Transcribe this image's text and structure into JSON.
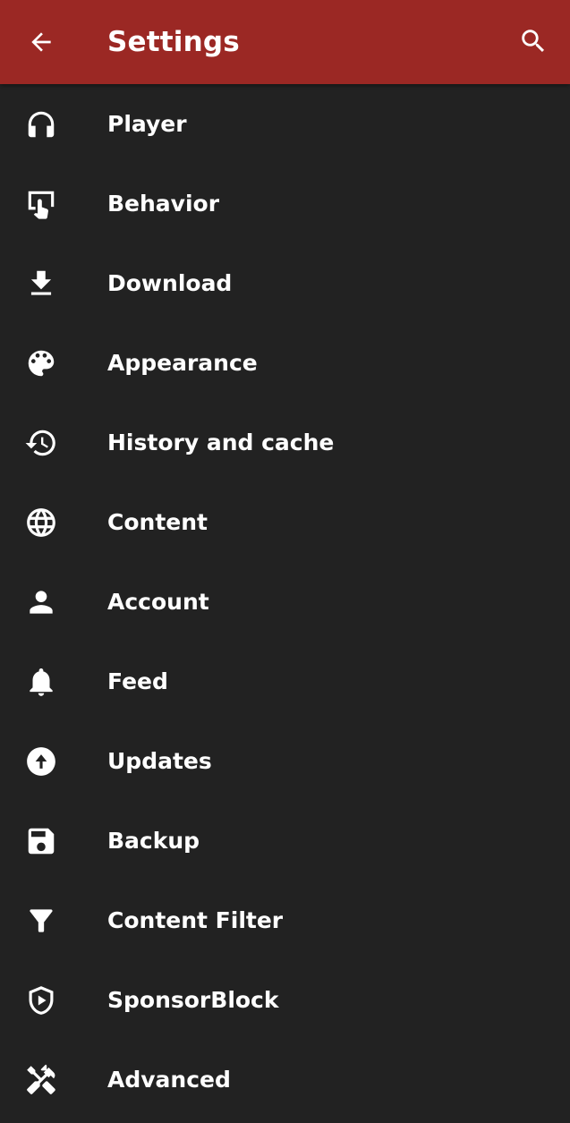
{
  "appbar": {
    "title": "Settings",
    "back_icon": "arrow-back-icon",
    "search_icon": "search-icon",
    "color": "#9b2824"
  },
  "theme": {
    "background": "#222222",
    "text": "#ffffff"
  },
  "settings": {
    "items": [
      {
        "label": "Player",
        "icon": "headphones-icon"
      },
      {
        "label": "Behavior",
        "icon": "touch-screen-icon"
      },
      {
        "label": "Download",
        "icon": "download-icon"
      },
      {
        "label": "Appearance",
        "icon": "palette-icon"
      },
      {
        "label": "History and cache",
        "icon": "history-icon"
      },
      {
        "label": "Content",
        "icon": "globe-icon"
      },
      {
        "label": "Account",
        "icon": "person-icon"
      },
      {
        "label": "Feed",
        "icon": "bell-icon"
      },
      {
        "label": "Updates",
        "icon": "upload-circle-icon"
      },
      {
        "label": "Backup",
        "icon": "save-icon"
      },
      {
        "label": "Content Filter",
        "icon": "filter-icon"
      },
      {
        "label": "SponsorBlock",
        "icon": "shield-play-icon"
      },
      {
        "label": "Advanced",
        "icon": "tools-icon"
      }
    ]
  }
}
